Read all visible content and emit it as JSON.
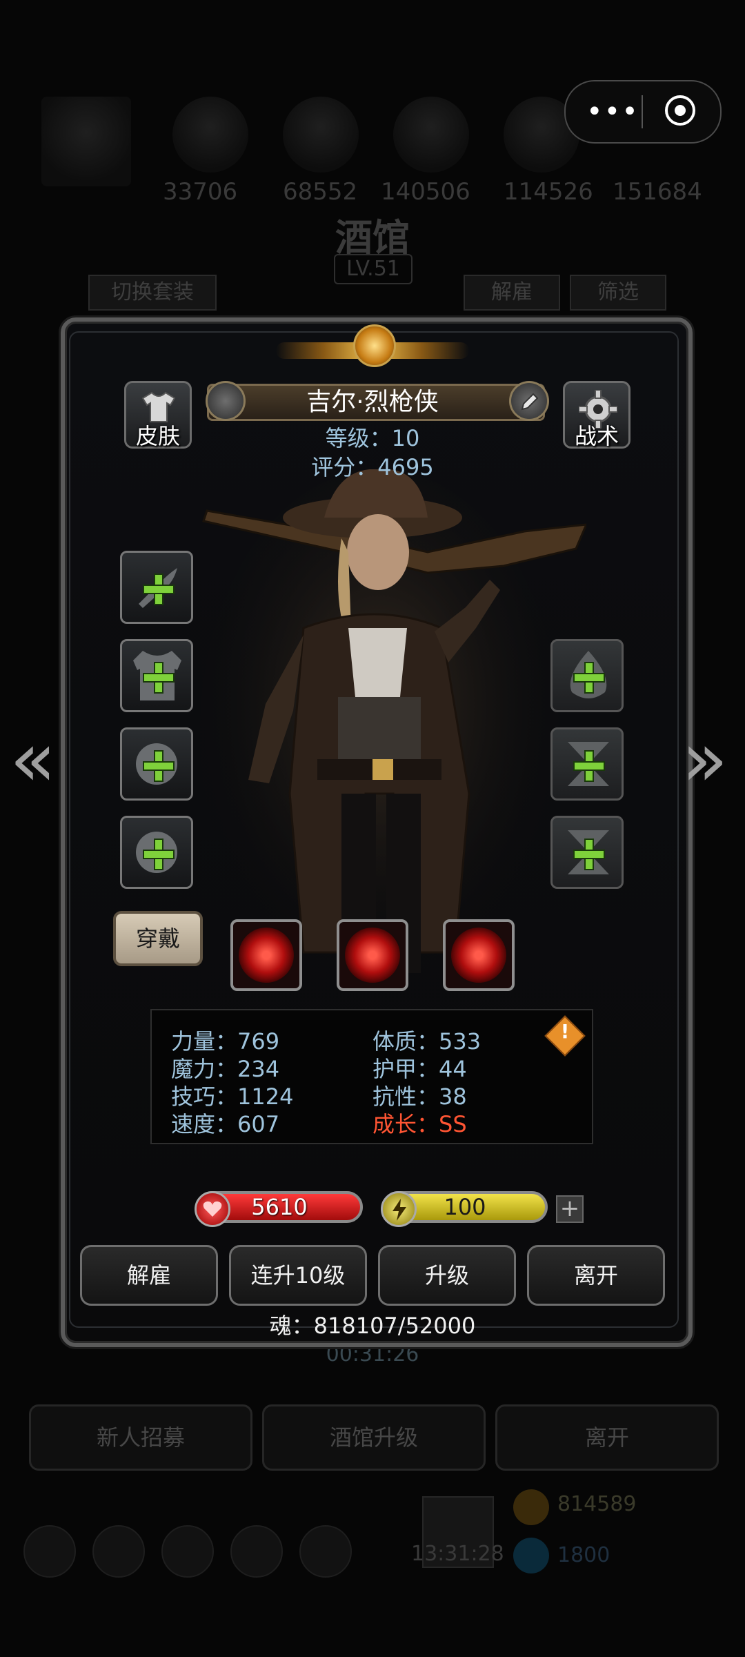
{
  "background": {
    "numbers": [
      "33706",
      "68552",
      "140506",
      "114526",
      "151684"
    ],
    "title": "酒馆",
    "level": "LV.51",
    "tabs": [
      "切换套装",
      "解雇",
      "筛选"
    ],
    "timer": "00:31:26",
    "buttons": [
      "新人招募",
      "酒馆升级",
      "离开"
    ],
    "clock": "13:31:28",
    "resources": [
      "814589",
      "1800"
    ]
  },
  "hero": {
    "name": "吉尔·烈枪侠",
    "level_label": "等级：10",
    "score_label": "评分：4695",
    "skin_label": "皮肤",
    "tactics_label": "战术",
    "wear_label": "穿戴"
  },
  "stats": {
    "strength": "力量：769",
    "magic": "魔力：234",
    "skill": "技巧：1124",
    "speed": "速度：607",
    "constitution": "体质：533",
    "armor": "护甲：44",
    "resistance": "抗性：38",
    "growth": "成长：SS"
  },
  "bars": {
    "hp": "5610",
    "energy": "100"
  },
  "actions": {
    "dismiss": "解雇",
    "level10": "连升10级",
    "upgrade": "升级",
    "leave": "离开"
  },
  "soul": "魂：818107/52000",
  "colors": {
    "stat_text": "#9fc4dd",
    "growth_text": "#ff5533",
    "hp_bar": "#cc1111",
    "energy_bar": "#d6c51a",
    "plus_green": "#7fd13b"
  }
}
